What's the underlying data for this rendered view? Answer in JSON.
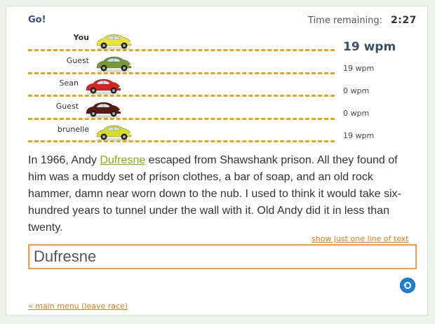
{
  "header": {
    "go_label": "Go!",
    "time_label": "Time remaining:",
    "time_value": "2:27"
  },
  "racers": [
    {
      "name": "You",
      "wpm": "19 wpm",
      "car_color": "#e8e43a"
    },
    {
      "name": "Guest",
      "wpm": "19 wpm",
      "car_color": "#7a9a3a"
    },
    {
      "name": "Sean",
      "wpm": "0 wpm",
      "car_color": "#d42424"
    },
    {
      "name": "Guest",
      "wpm": "0 wpm",
      "car_color": "#5a1c10"
    },
    {
      "name": "brunelle",
      "wpm": "19 wpm",
      "car_color": "#d6e02a"
    }
  ],
  "passage": {
    "before": "In 1966, Andy ",
    "current": "Dufresne",
    "after": " escaped from Shawshank prison. All they found of him was a muddy set of prison clothes, a bar of soap, and an old rock hammer, damn near worn down to the nub. I used to think it would take six-hundred years to tunnel under the wall with it. Old Andy did it in less than twenty."
  },
  "controls": {
    "one_line_link": "show just one line of text",
    "input_value": "Dufresne",
    "main_menu_link": "« main menu (leave race)"
  },
  "colors": {
    "track_dash": "#e0a91c",
    "link_orange": "#e07a1a",
    "current_word": "#7ab800",
    "header_blue": "#34508a"
  },
  "icons": {
    "refresh": "refresh-icon",
    "car": "car-icon"
  }
}
